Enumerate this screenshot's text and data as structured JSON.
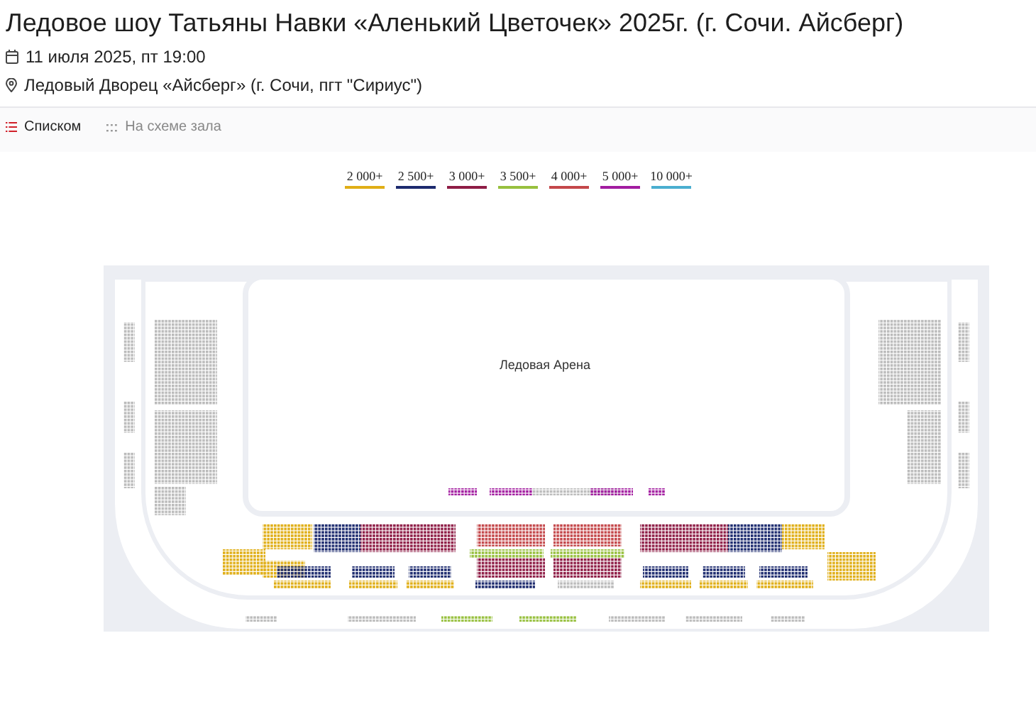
{
  "title": "Ледовое шоу Татьяны Навки «Аленький Цветочек» 2025г. (г. Сочи. Айсберг)",
  "date": "11 июля 2025, пт 19:00",
  "venue": "Ледовый Дворец «Айсберг» (г. Сочи, пгт \"Сириус\")",
  "tabs": [
    {
      "label": "Списком",
      "selected": true
    },
    {
      "label": "На схеме зала",
      "selected": false
    }
  ],
  "price_legend": [
    {
      "label": "2 000+",
      "color": "#e0ae16"
    },
    {
      "label": "2 500+",
      "color": "#1c2a6e"
    },
    {
      "label": "3 000+",
      "color": "#8e1c45"
    },
    {
      "label": "3 500+",
      "color": "#97c03e"
    },
    {
      "label": "4 000+",
      "color": "#c4474a"
    },
    {
      "label": "5 000+",
      "color": "#a21ca0"
    },
    {
      "label": "10 000+",
      "color": "#4aaed0"
    }
  ],
  "hall_map": {
    "arena_label": "Ледовая Арена"
  }
}
